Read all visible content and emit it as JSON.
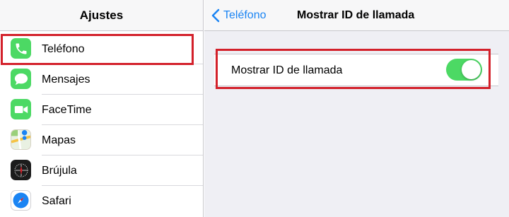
{
  "left_panel": {
    "title": "Ajustes",
    "items": [
      {
        "label": "Teléfono",
        "icon": "phone-icon",
        "color": "#4cd964"
      },
      {
        "label": "Mensajes",
        "icon": "messages-icon",
        "color": "#4cd964"
      },
      {
        "label": "FaceTime",
        "icon": "facetime-icon",
        "color": "#4cd964"
      },
      {
        "label": "Mapas",
        "icon": "maps-icon",
        "color": "#e8e4d0"
      },
      {
        "label": "Brújula",
        "icon": "compass-icon",
        "color": "#1c1c1c"
      },
      {
        "label": "Safari",
        "icon": "safari-icon",
        "color": "#1a84f3"
      }
    ]
  },
  "right_panel": {
    "back_label": "Teléfono",
    "title": "Mostrar ID de llamada",
    "setting": {
      "label": "Mostrar ID de llamada",
      "toggle_on": true
    }
  },
  "colors": {
    "highlight": "#d3202a",
    "accent": "#1a84f3",
    "toggle_on": "#4cd964"
  }
}
